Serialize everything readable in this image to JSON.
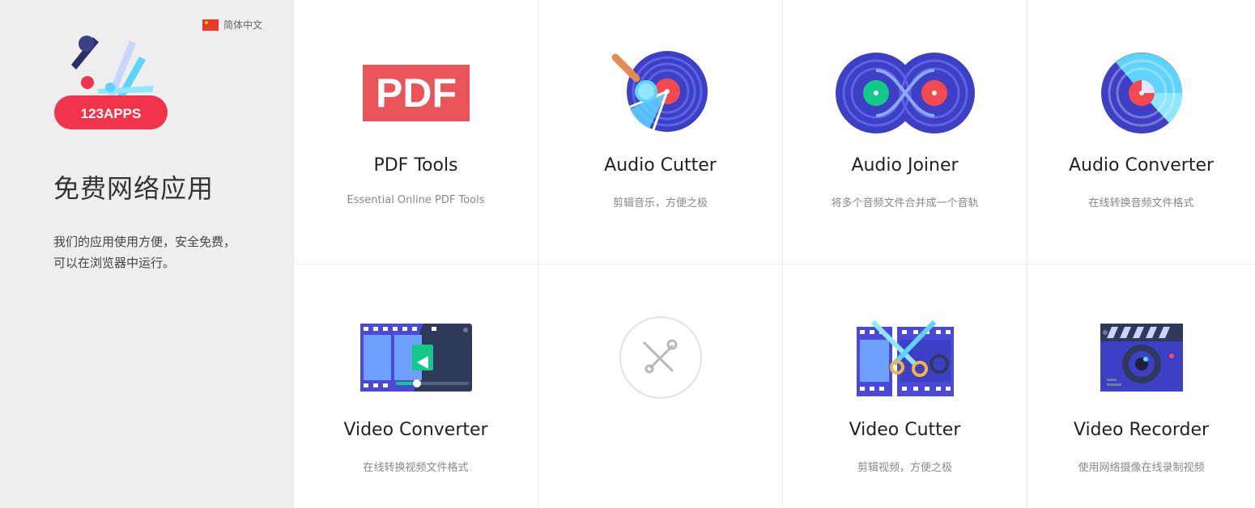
{
  "sidebar": {
    "language": "简体中文",
    "logo_text": "123APPS",
    "title": "免费网络应用",
    "description_line1": "我们的应用使用方便，安全免费，",
    "description_line2": "可以在浏览器中运行。"
  },
  "tools": [
    {
      "name": "PDF Tools",
      "subtitle": "Essential Online PDF Tools",
      "icon": "pdf-icon",
      "icon_text": "PDF"
    },
    {
      "name": "Audio Cutter",
      "subtitle": "剪辑音乐，方便之极",
      "icon": "audio-cutter-icon"
    },
    {
      "name": "Audio Joiner",
      "subtitle": "将多个音频文件合并成一个音轨",
      "icon": "audio-joiner-icon"
    },
    {
      "name": "Audio Converter",
      "subtitle": "在线转换音频文件格式",
      "icon": "audio-converter-icon"
    },
    {
      "name": "Video Converter",
      "subtitle": "在线转换视频文件格式",
      "icon": "video-converter-icon"
    },
    {
      "name": "",
      "subtitle": "",
      "icon": "tools-icon"
    },
    {
      "name": "Video Cutter",
      "subtitle": "剪辑视频，方便之极",
      "icon": "video-cutter-icon"
    },
    {
      "name": "Video Recorder",
      "subtitle": "使用网络摄像在线录制视频",
      "icon": "video-recorder-icon"
    }
  ],
  "colors": {
    "sidebar_bg": "#eeeeee",
    "brand_red": "#f0344b",
    "pdf_red": "#e9545a",
    "vinyl_blue": "#4a4ad6",
    "accent_cyan": "#5fd3ff"
  }
}
